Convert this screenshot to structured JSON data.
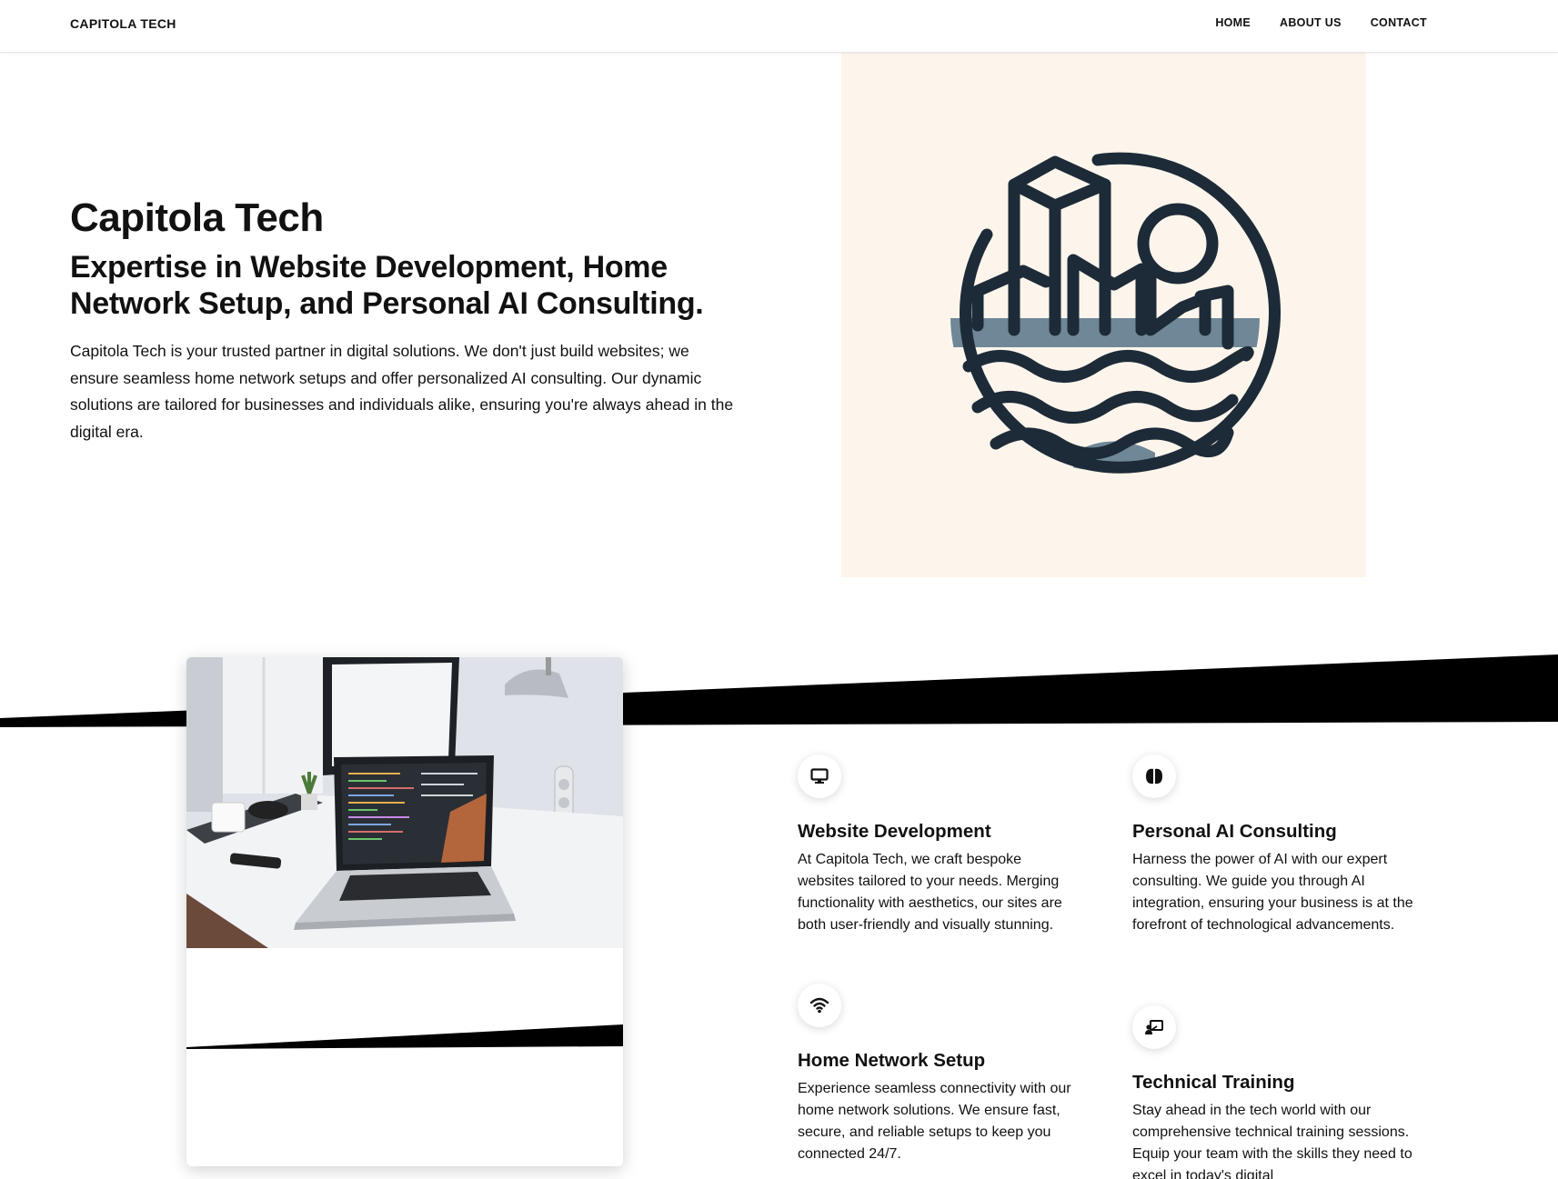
{
  "nav": {
    "brand": "CAPITOLA TECH",
    "links": [
      "HOME",
      "ABOUT US",
      "CONTACT"
    ]
  },
  "hero": {
    "title": "Capitola Tech",
    "subtitle": "Expertise in Website Development, Home Network Setup, and Personal AI Consulting.",
    "description": "Capitola Tech is your trusted partner in digital solutions. We don't just build websites; we ensure seamless home network setups and offer personalized AI consulting. Our dynamic solutions are tailored for businesses and individuals alike, ensuring you're always ahead in the digital era.",
    "logo_icon": "city-waves-logo-icon"
  },
  "services": [
    {
      "icon": "monitor-icon",
      "title": "Website Development",
      "description": "At Capitola Tech, we craft bespoke websites tailored to your needs. Merging functionality with aesthetics, our sites are both user-friendly and visually stunning."
    },
    {
      "icon": "brain-icon",
      "title": "Personal AI Consulting",
      "description": "Harness the power of AI with our expert consulting. We guide you through AI integration, ensuring your business is at the forefront of technological advancements."
    },
    {
      "icon": "wifi-icon",
      "title": "Home Network Setup",
      "description": "Experience seamless connectivity with our home network solutions. We ensure fast, secure, and reliable setups to keep you connected 24/7."
    },
    {
      "icon": "teacher-icon",
      "title": "Technical Training",
      "description": "Stay ahead in the tech world with our comprehensive technical training sessions. Equip your team with the skills they need to excel in today's digital"
    }
  ],
  "colors": {
    "logo_dark": "#1d2b38",
    "logo_accent": "#6f8797",
    "logo_bg": "#fdf5ec",
    "band": "#000000"
  }
}
